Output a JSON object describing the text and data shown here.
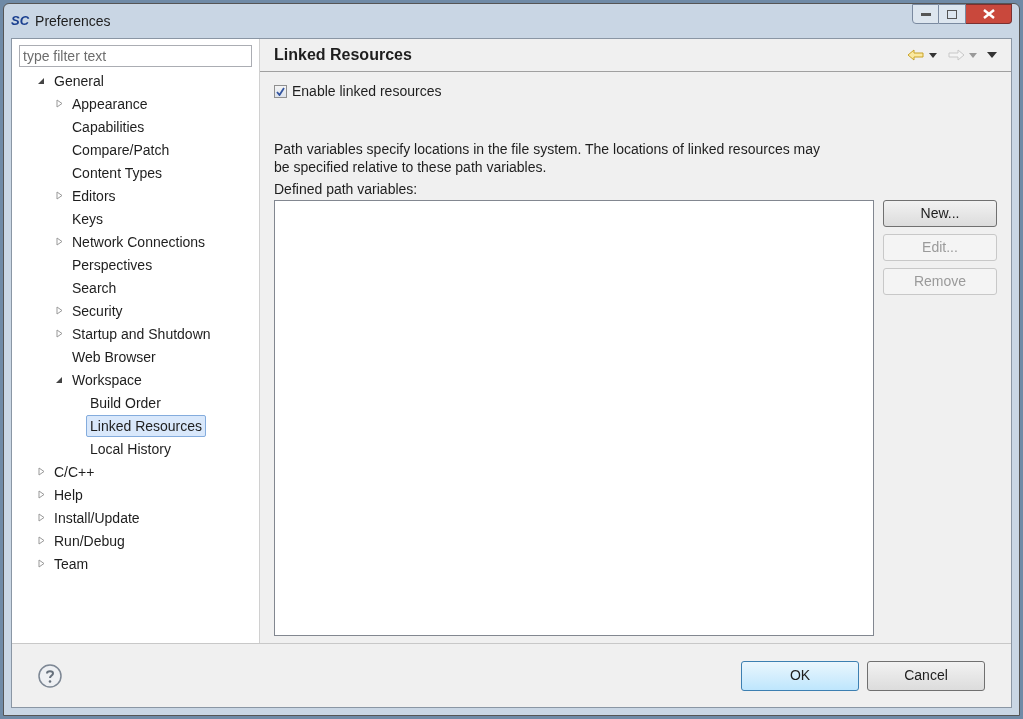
{
  "window": {
    "logo": "SC",
    "title": "Preferences"
  },
  "filter": {
    "placeholder": "type filter text"
  },
  "tree": [
    {
      "label": "General",
      "expanded": true,
      "selected": false,
      "children": [
        {
          "label": "Appearance",
          "expanded": false,
          "selected": false
        },
        {
          "label": "Capabilities",
          "selected": false
        },
        {
          "label": "Compare/Patch",
          "selected": false
        },
        {
          "label": "Content Types",
          "selected": false
        },
        {
          "label": "Editors",
          "expanded": false,
          "selected": false
        },
        {
          "label": "Keys",
          "selected": false
        },
        {
          "label": "Network Connections",
          "expanded": false,
          "selected": false
        },
        {
          "label": "Perspectives",
          "selected": false
        },
        {
          "label": "Search",
          "selected": false
        },
        {
          "label": "Security",
          "expanded": false,
          "selected": false
        },
        {
          "label": "Startup and Shutdown",
          "expanded": false,
          "selected": false
        },
        {
          "label": "Web Browser",
          "selected": false
        },
        {
          "label": "Workspace",
          "expanded": true,
          "selected": false,
          "children": [
            {
              "label": "Build Order",
              "selected": false
            },
            {
              "label": "Linked Resources",
              "selected": true
            },
            {
              "label": "Local History",
              "selected": false
            }
          ]
        }
      ]
    },
    {
      "label": "C/C++",
      "expanded": false,
      "selected": false
    },
    {
      "label": "Help",
      "expanded": false,
      "selected": false
    },
    {
      "label": "Install/Update",
      "expanded": false,
      "selected": false
    },
    {
      "label": "Run/Debug",
      "expanded": false,
      "selected": false
    },
    {
      "label": "Team",
      "expanded": false,
      "selected": false
    }
  ],
  "page": {
    "title": "Linked Resources",
    "enable_checkbox": {
      "label": "Enable linked resources",
      "checked": true
    },
    "description": "Path variables specify locations in the file system. The locations of linked resources may be specified relative to these path variables.",
    "list_label": "Defined path variables:",
    "buttons": [
      {
        "label": "New...",
        "disabled": false
      },
      {
        "label": "Edit...",
        "disabled": true
      },
      {
        "label": "Remove",
        "disabled": true
      }
    ]
  },
  "footer": {
    "buttons": [
      {
        "label": "OK",
        "default": true
      },
      {
        "label": "Cancel",
        "default": false
      }
    ]
  }
}
